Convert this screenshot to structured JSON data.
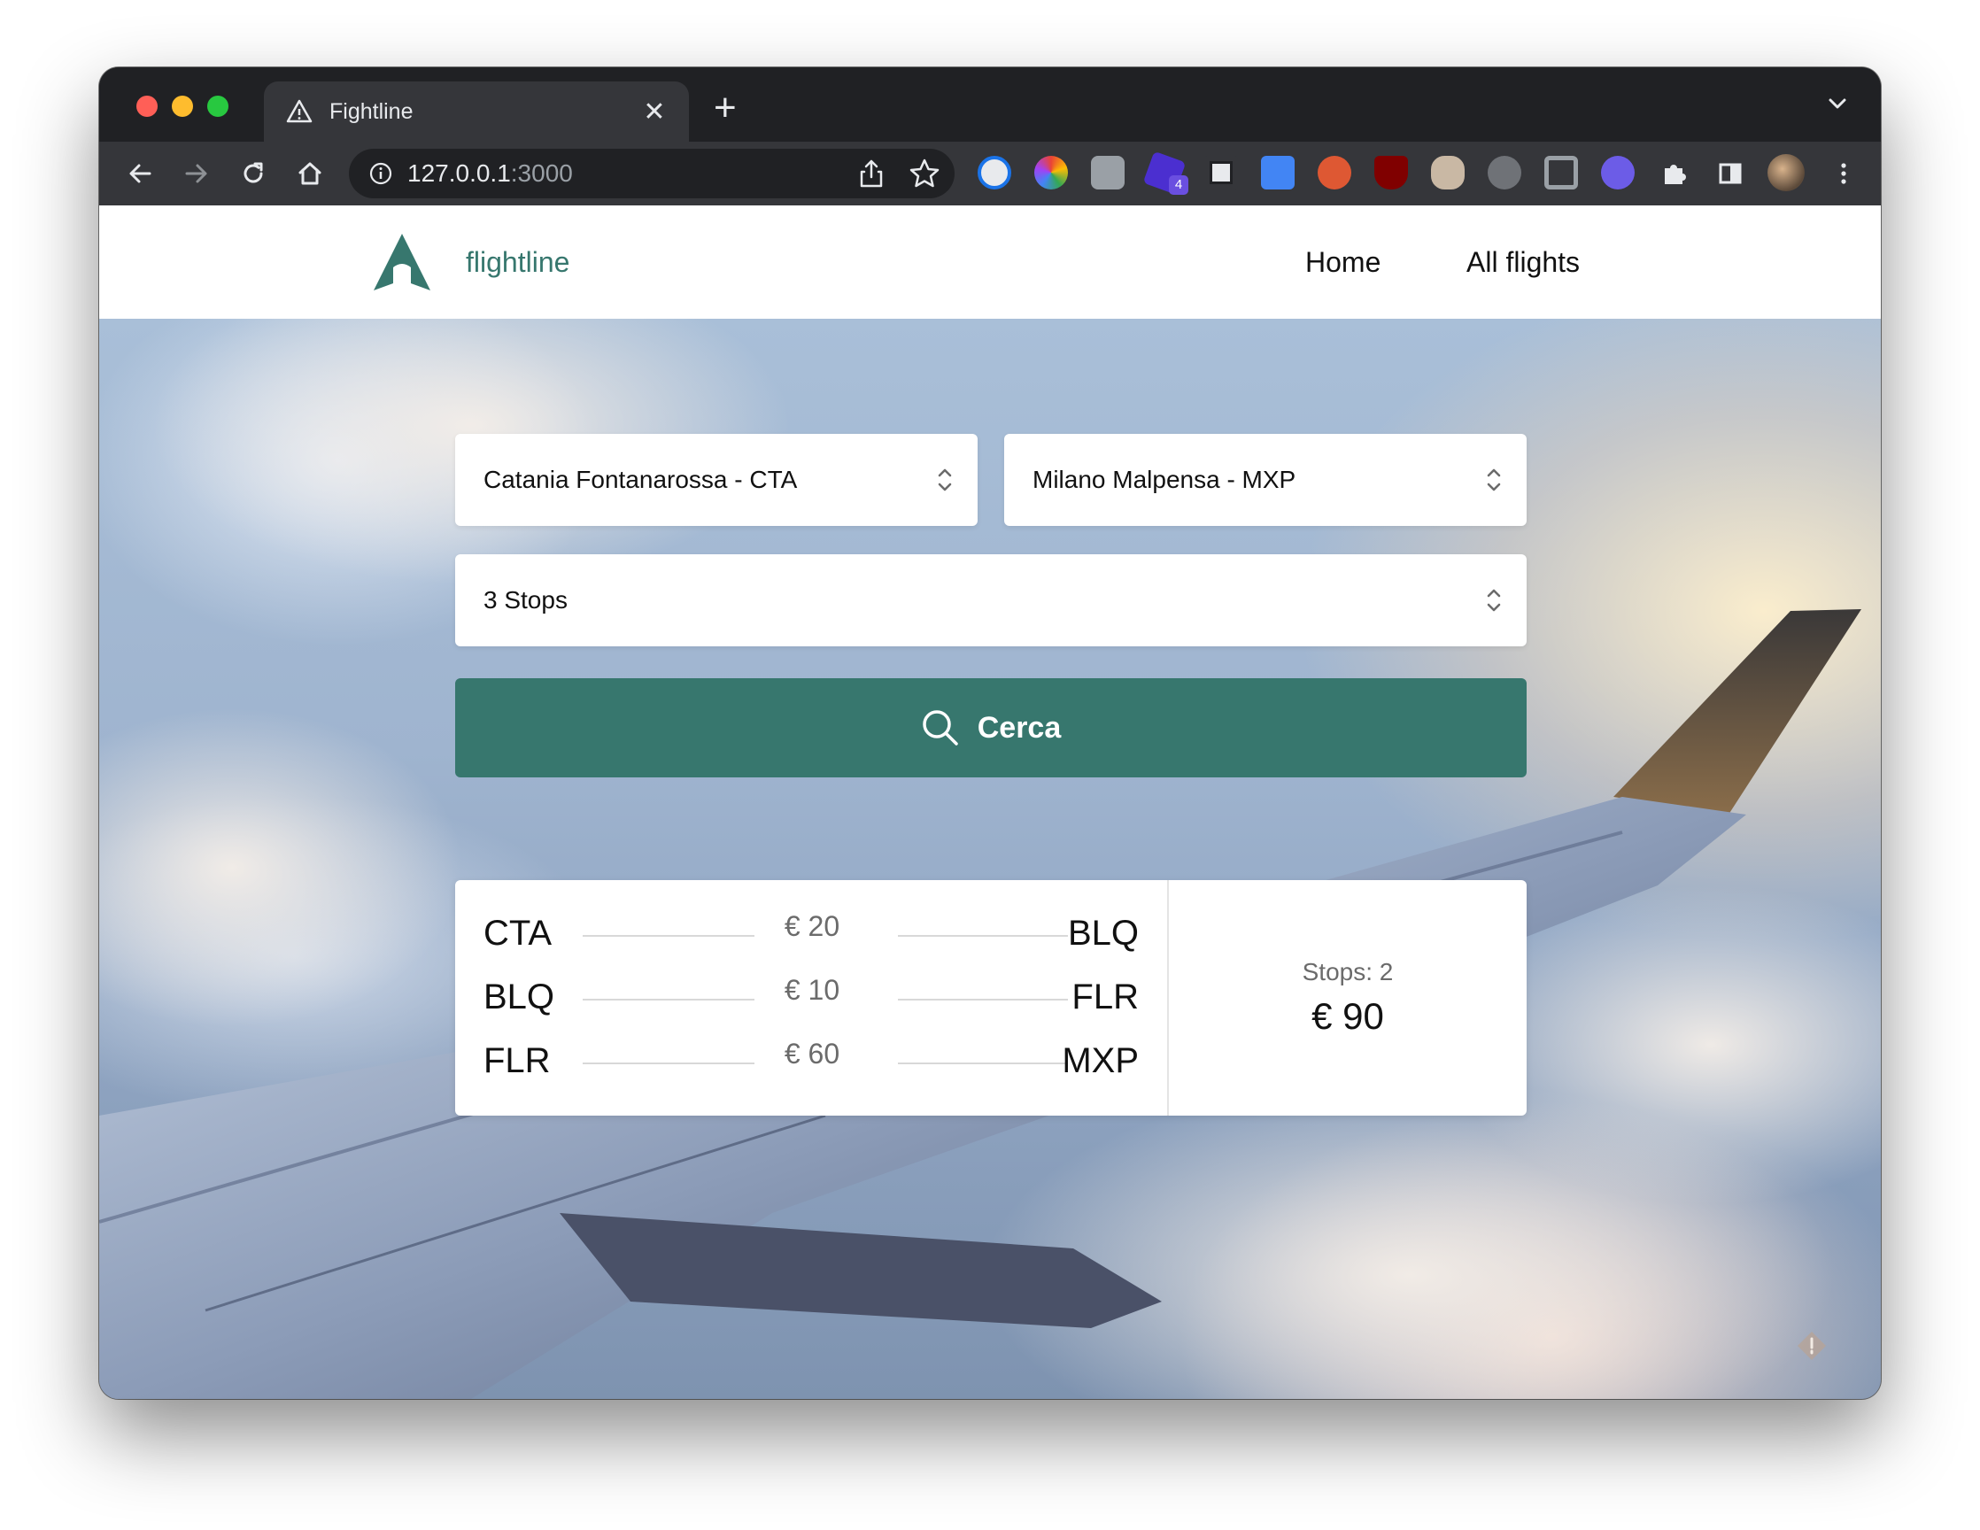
{
  "browser": {
    "tab_title": "Fightline",
    "url_host": "127.0.0.1",
    "url_port": ":3000",
    "extension_badge": "4"
  },
  "navbar": {
    "brand": "flightline",
    "links": [
      "Home",
      "All flights"
    ]
  },
  "search": {
    "origin": "Catania Fontanarossa - CTA",
    "destination": "Milano Malpensa - MXP",
    "stops": "3 Stops",
    "button_label": "Cerca"
  },
  "result": {
    "legs": [
      {
        "from": "CTA",
        "price": "€ 20",
        "to": "BLQ"
      },
      {
        "from": "BLQ",
        "price": "€ 10",
        "to": "FLR"
      },
      {
        "from": "FLR",
        "price": "€ 60",
        "to": "MXP"
      }
    ],
    "stops_text": "Stops: 2",
    "total": "€ 90"
  },
  "colors": {
    "brand": "#37776e",
    "browser_frame": "#202124",
    "browser_toolbar": "#35363a"
  }
}
